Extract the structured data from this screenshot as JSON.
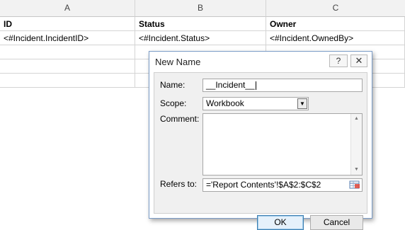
{
  "sheet": {
    "columns": [
      "A",
      "B",
      "C"
    ],
    "headers": [
      "ID",
      "Status",
      "Owner"
    ],
    "row2": [
      "<#Incident.IncidentID>",
      "<#Incident.Status>",
      "<#Incident.OwnedBy>"
    ]
  },
  "dialog": {
    "title": "New Name",
    "help_glyph": "?",
    "close_glyph": "✕",
    "name_label": "Name:",
    "name_value": "__Incident__",
    "scope_label": "Scope:",
    "scope_value": "Workbook",
    "comment_label": "Comment:",
    "comment_value": "",
    "refers_label": "Refers to:",
    "refers_value": "='Report Contents'!$A$2:$C$2",
    "ok_label": "OK",
    "cancel_label": "Cancel"
  }
}
